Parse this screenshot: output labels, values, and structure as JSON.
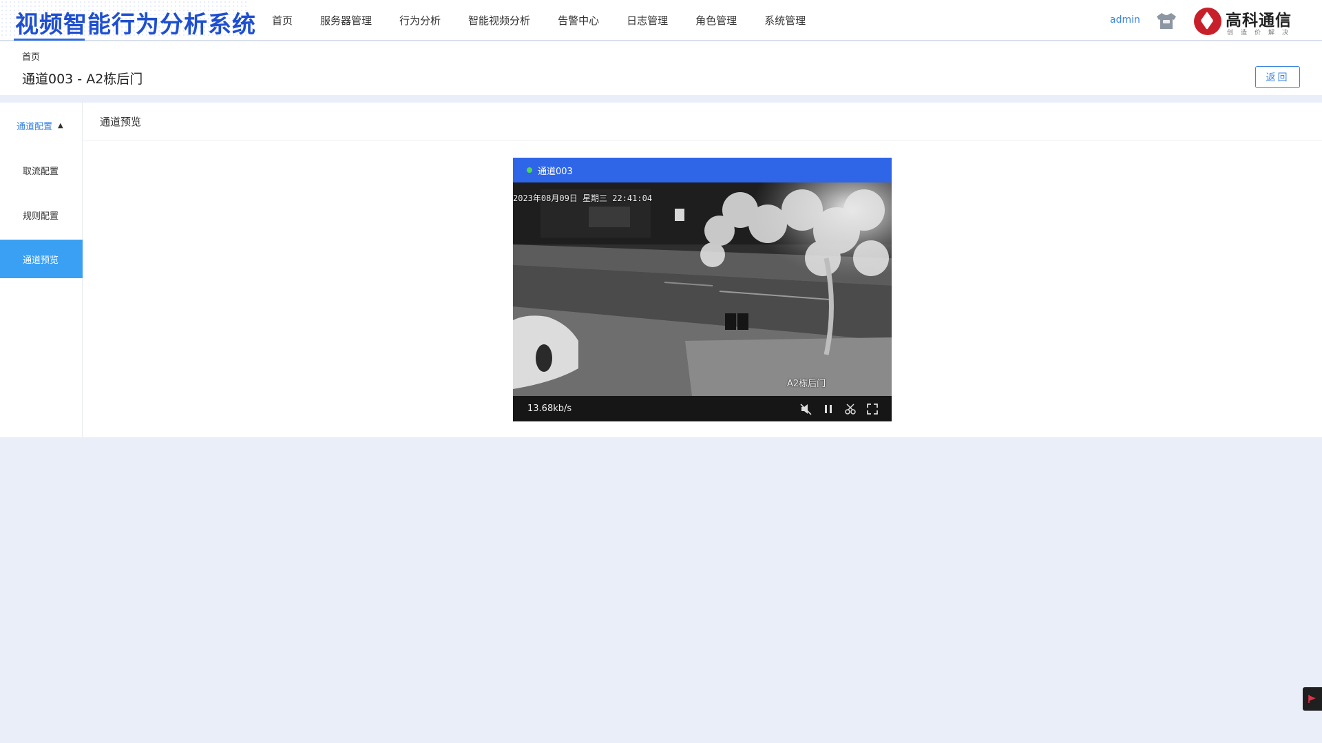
{
  "app": {
    "title": "视频智能行为分析系统"
  },
  "nav": {
    "items": [
      "首页",
      "服务器管理",
      "行为分析",
      "智能视频分析",
      "告警中心",
      "日志管理",
      "角色管理",
      "系统管理"
    ]
  },
  "user": {
    "name": "admin",
    "icon": "user-avatar-icon"
  },
  "brand": {
    "name": "高科通信",
    "tagline": "创造价解决",
    "color": "#c8202a"
  },
  "header": {
    "breadcrumb": "首页",
    "title": "通道003 - A2栋后门",
    "back_label": "返回"
  },
  "sidebar": {
    "group_label": "通道配置",
    "items": [
      {
        "label": "取流配置",
        "active": false
      },
      {
        "label": "规则配置",
        "active": false
      },
      {
        "label": "通道预览",
        "active": true
      }
    ]
  },
  "content": {
    "section_title": "通道预览"
  },
  "player": {
    "channel_name": "通道003",
    "status_color": "#4fd84f",
    "osd_time": "2023年08月09日 星期三 22:41:04",
    "osd_location": "A2栋后门",
    "bitrate": "13.68kb/s",
    "controls": [
      "mute-icon",
      "pause-icon",
      "screenshot-icon",
      "fullscreen-icon"
    ]
  },
  "colors": {
    "accent": "#2f66e8",
    "link": "#3a83e0",
    "active_menu": "#3aa0f3",
    "title": "#1e4fd1"
  }
}
